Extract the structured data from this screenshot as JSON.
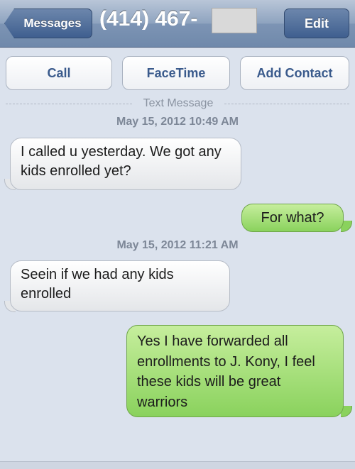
{
  "navbar": {
    "back_label": "Messages",
    "title": "(414) 467-",
    "edit_label": "Edit"
  },
  "actions": {
    "call": "Call",
    "facetime": "FaceTime",
    "add_contact": "Add Contact"
  },
  "thread": {
    "separator_label": "Text Message",
    "timestamps": [
      "May 15, 2012 10:49 AM",
      "May 15, 2012 11:21 AM"
    ],
    "messages": [
      {
        "direction": "incoming",
        "text": "I called u yesterday. We got any kids enrolled yet?"
      },
      {
        "direction": "outgoing",
        "text": "For what?"
      },
      {
        "direction": "incoming",
        "text": "Seein if we had any kids enrolled"
      },
      {
        "direction": "outgoing",
        "text": "Yes I have forwarded all enrollments to J. Kony, I feel these kids will be great warriors"
      }
    ]
  },
  "colors": {
    "outgoing_bubble": "#8ad25d",
    "incoming_bubble": "#ffffff",
    "background": "#dbe2ed",
    "nav_bar": "#7d94b4"
  }
}
